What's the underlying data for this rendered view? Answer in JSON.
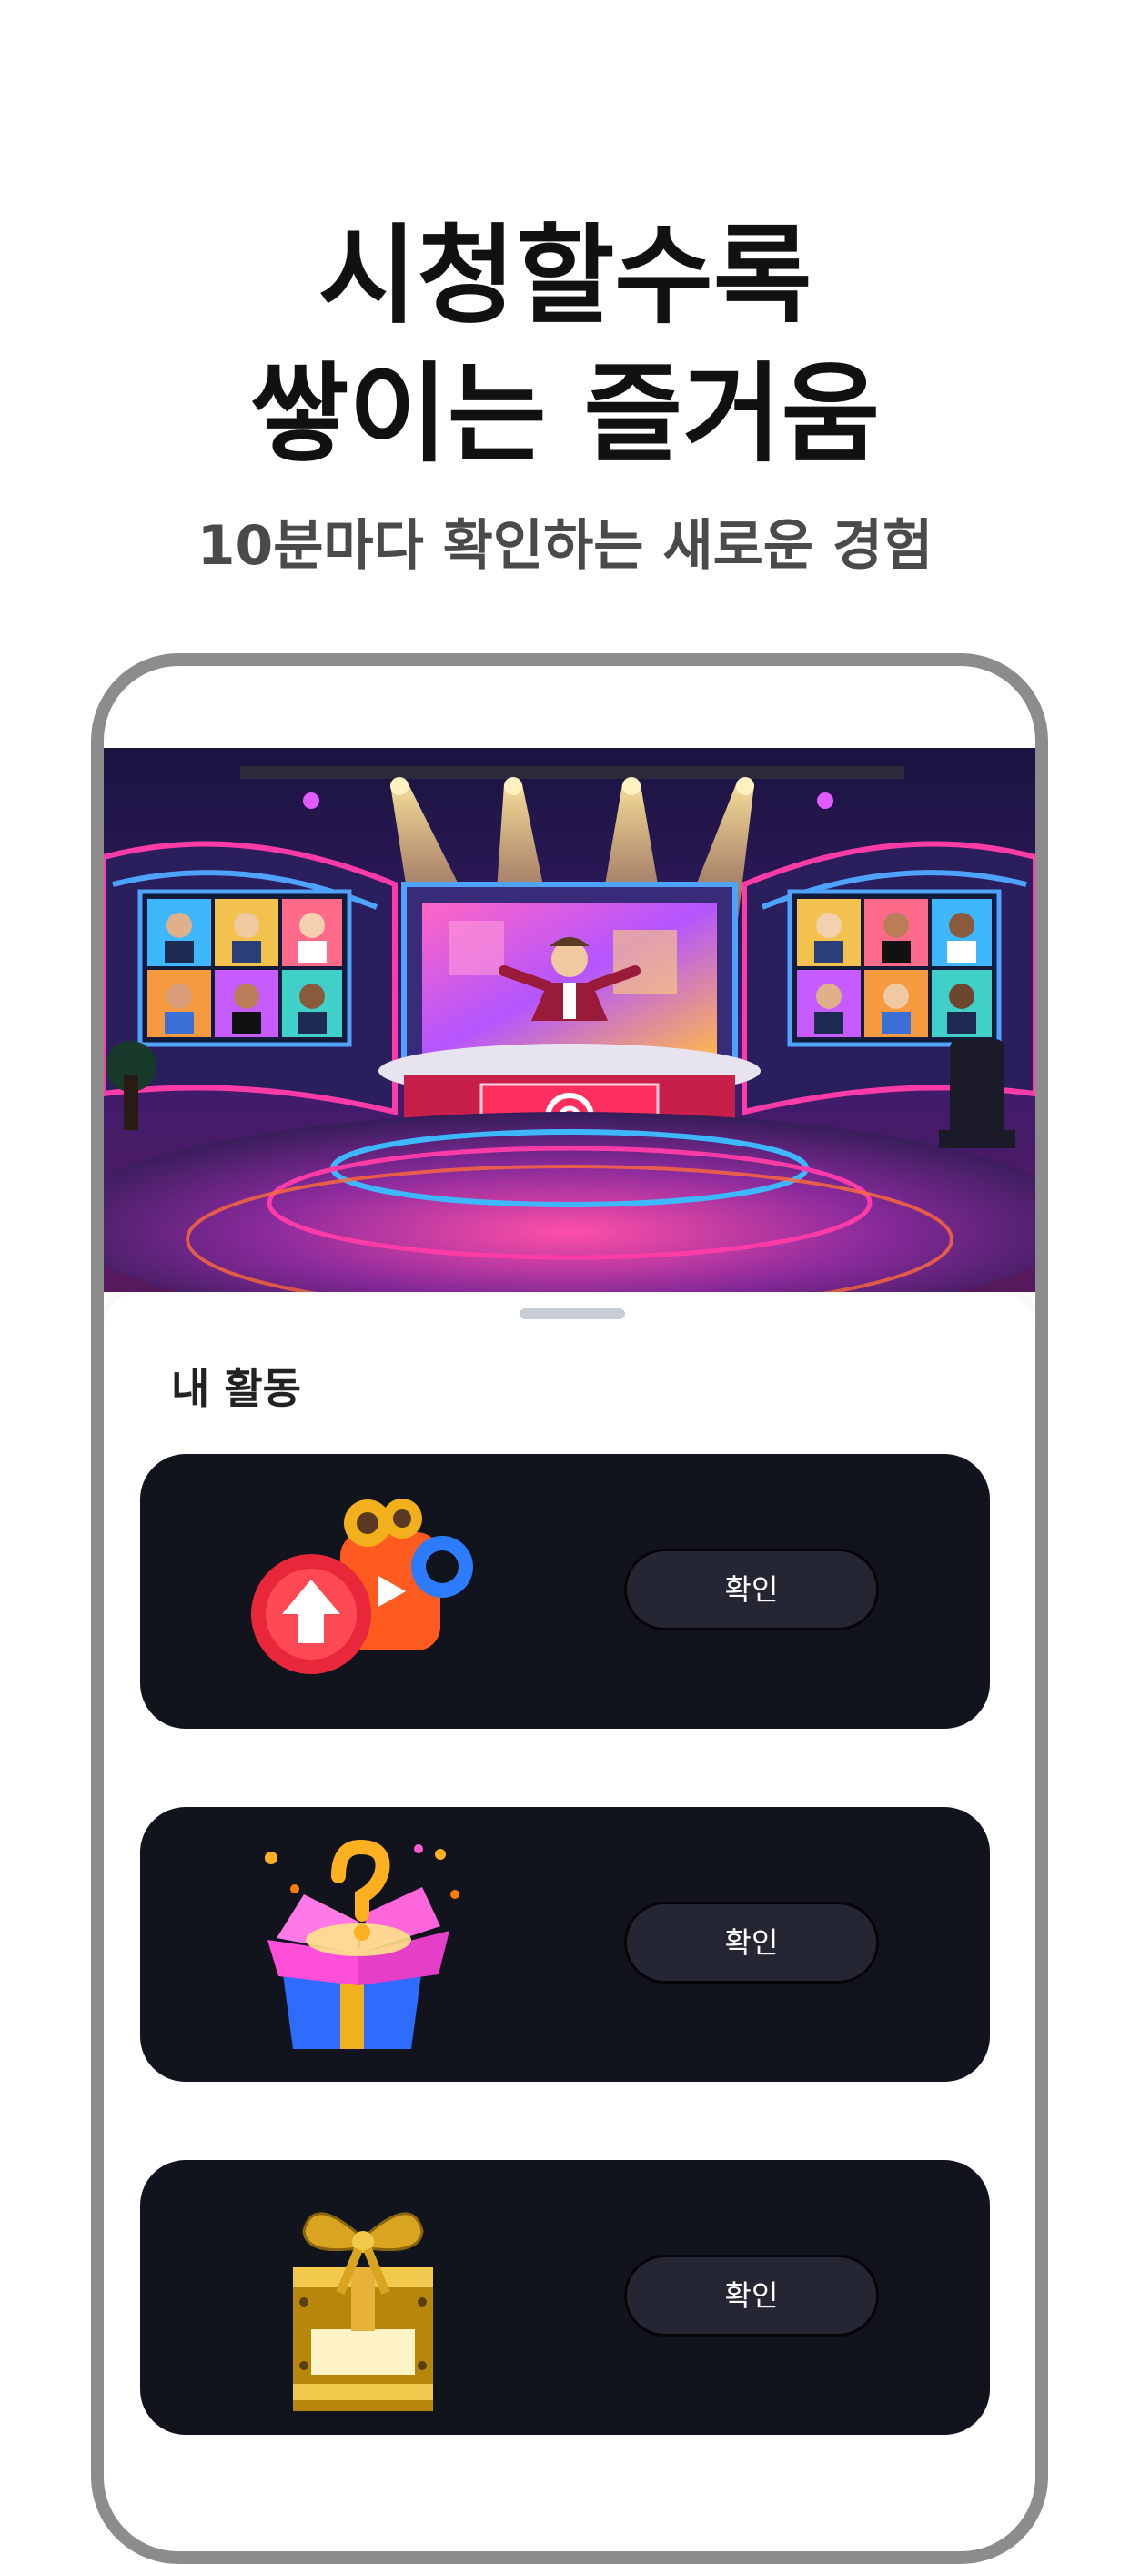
{
  "hero": {
    "title_line1": "시청할수록",
    "title_line2": "쌓이는 즐거움",
    "subtitle": "10분마다 확인하는 새로운 경험"
  },
  "activity": {
    "section_title": "내 활동",
    "cards": [
      {
        "illustration": "play-video-icon",
        "button_label": "확인"
      },
      {
        "illustration": "mystery-gift-box-icon",
        "button_label": "확인"
      },
      {
        "illustration": "golden-gift-box-icon",
        "button_label": "확인"
      }
    ]
  },
  "banner": {
    "scene": "tv-show-studio-illustration",
    "colors": {
      "pink": "#ff3ba8",
      "blue": "#2f6bff",
      "purple": "#5a2a8c",
      "gold": "#ffb84d"
    }
  }
}
